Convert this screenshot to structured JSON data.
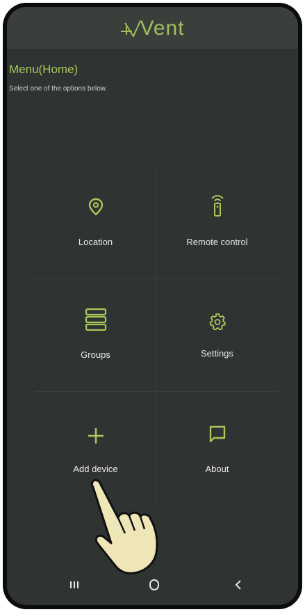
{
  "app": {
    "logo_text": "Vent",
    "accent_color": "#a8c85a",
    "background_color": "#2f3331"
  },
  "page": {
    "title": "Menu(Home)",
    "subtitle": "Select one of the options below."
  },
  "menu": {
    "items": [
      {
        "label": "Location",
        "icon": "location-pin-icon"
      },
      {
        "label": "Remote control",
        "icon": "remote-control-icon"
      },
      {
        "label": "Groups",
        "icon": "groups-list-icon"
      },
      {
        "label": "Settings",
        "icon": "gear-icon"
      },
      {
        "label": "Add device",
        "icon": "plus-icon"
      },
      {
        "label": "About",
        "icon": "chat-bubble-icon"
      }
    ]
  },
  "navbar": {
    "buttons": [
      "recent-apps",
      "home",
      "back"
    ]
  },
  "overlay": {
    "pointer": "hand-pointer-icon"
  }
}
